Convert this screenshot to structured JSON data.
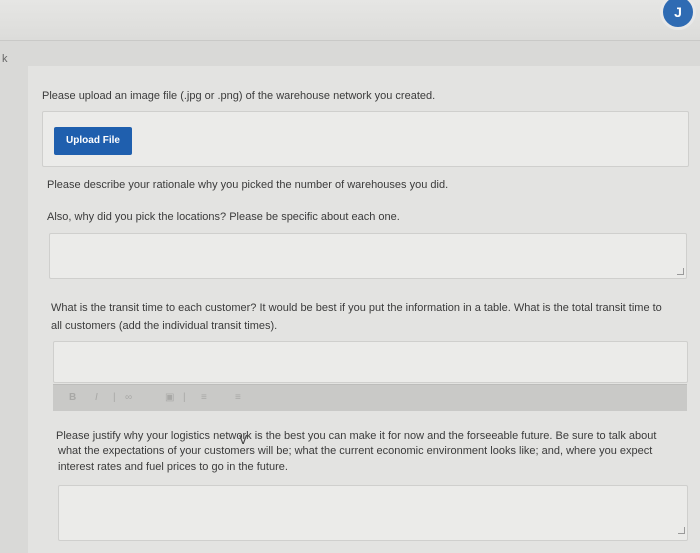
{
  "topbar": {
    "avatar_glyph": "J"
  },
  "left_marker": "k",
  "upload": {
    "prompt": "Please upload an image file (.jpg or .png) of the warehouse network you created.",
    "button_label": "Upload File"
  },
  "rationale": {
    "prompt1": "Please describe your rationale why you picked the number of warehouses you did.",
    "prompt2": "Also, why did you pick the locations? Please be specific about each one."
  },
  "transit": {
    "prompt_line1": "What is the transit time to each customer? It would be best if you put the information in a table. What is the total transit time to",
    "prompt_line2": "all customers (add the individual transit times)."
  },
  "toolbar": {
    "bold": "B",
    "italic": "I",
    "separator": "|"
  },
  "justify": {
    "line1": "Please justify why your logistics network is the best you can make it for now and the forseeable future. Be sure to talk about",
    "line2": "what the expectations of your customers will be; what the current economic environment looks like; and, where you expect",
    "line3": "interest rates and fuel prices to go in the future."
  },
  "colors": {
    "accent": "#1f5fae",
    "background": "#d9d9d7"
  }
}
